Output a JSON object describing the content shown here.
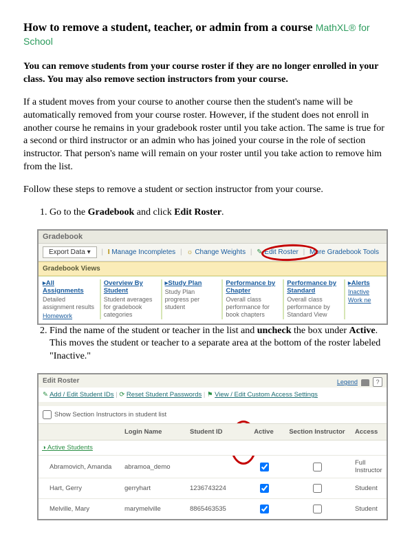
{
  "header": {
    "title": "How to remove a student, teacher, or admin from a course",
    "brand": "MathXL® for School"
  },
  "intro_bold": "You can remove students from your course roster if they are no longer enrolled in your class.  You may also remove section instructors from your course.",
  "intro_detail": "If a student moves from your course to another course then the student's name will be automatically removed from your course roster. However, if the student does not enroll in another course he remains in your gradebook roster until you take action. The same is true for a second or third instructor or an admin who has joined your course in the role of section instructor. That person's name will remain on your roster until you take action to remove him from the list.",
  "follow_steps": "Follow these steps to remove a student or section instructor from your course.",
  "step1": {
    "pre": "Go to the ",
    "b1": "Gradebook",
    "mid": " and click ",
    "b2": "Edit Roster",
    "post": "."
  },
  "step2": {
    "pre": "Find the name of the student or teacher in the list and ",
    "b1": "uncheck",
    "mid": " the box under ",
    "b2": "Active",
    "post": ". This moves the student or teacher to a separate area at the bottom of the roster labeled \"Inactive.\""
  },
  "gradebook": {
    "title": "Gradebook",
    "export": "Export Data ▾",
    "manage": "Manage Incompletes",
    "weights": "Change Weights",
    "edit_roster": "Edit Roster",
    "more": "More Gradebook Tools",
    "views_label": "Gradebook Views",
    "cols": [
      {
        "hd": "▸All Assignments",
        "desc": "Detailed assignment results",
        "sub": "Homework"
      },
      {
        "hd": "Overview By Student",
        "desc": "Student averages for gradebook categories",
        "sub": ""
      },
      {
        "hd": "▸Study Plan",
        "desc": "Study Plan progress per student",
        "sub": ""
      },
      {
        "hd": "Performance by Chapter",
        "desc": "Overall class performance for book chapters",
        "sub": ""
      },
      {
        "hd": "Performance by Standard",
        "desc": "Overall class performance by Standard View",
        "sub": ""
      },
      {
        "hd": "▸Alerts",
        "desc": "",
        "sub": "Inactive",
        "sub2": "Work ne"
      }
    ]
  },
  "roster": {
    "title": "Edit Roster",
    "legend": "Legend",
    "toolbar": {
      "add": "Add / Edit Student IDs",
      "reset": "Reset Student Passwords",
      "access": "View / Edit Custom Access Settings"
    },
    "show_opt": "Show Section Instructors in student list",
    "headers": [
      "",
      "Login Name",
      "Student ID",
      "Active",
      "Section Instructor",
      "Access"
    ],
    "subheader": "Active Students",
    "rows": [
      {
        "name": "Abramovich, Amanda",
        "login": "abramoa_demo",
        "sid": "",
        "active": true,
        "section": false,
        "access": "Full Instructor"
      },
      {
        "name": "Hart, Gerry",
        "login": "gerryhart",
        "sid": "1236743224",
        "active": true,
        "section": false,
        "access": "Student"
      },
      {
        "name": "Melville, Mary",
        "login": "marymelville",
        "sid": "8865463535",
        "active": true,
        "section": false,
        "access": "Student"
      }
    ]
  }
}
